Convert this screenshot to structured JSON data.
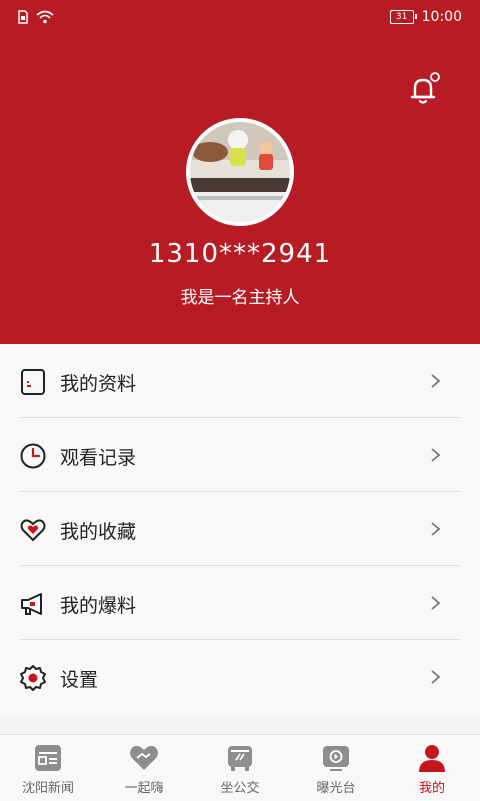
{
  "status_bar": {
    "time": "10:00",
    "battery": "31"
  },
  "profile": {
    "username": "1310***2941",
    "tagline": "我是一名主持人"
  },
  "menu": {
    "items": [
      {
        "label": "我的资料"
      },
      {
        "label": "观看记录"
      },
      {
        "label": "我的收藏"
      },
      {
        "label": "我的爆料"
      },
      {
        "label": "设置"
      }
    ]
  },
  "tabbar": {
    "tabs": [
      {
        "label": "沈阳新闻"
      },
      {
        "label": "一起嗨"
      },
      {
        "label": "坐公交"
      },
      {
        "label": "曝光台"
      },
      {
        "label": "我的"
      }
    ]
  },
  "colors": {
    "brand_red": "#b71c25",
    "active_tab": "#c4161c"
  }
}
